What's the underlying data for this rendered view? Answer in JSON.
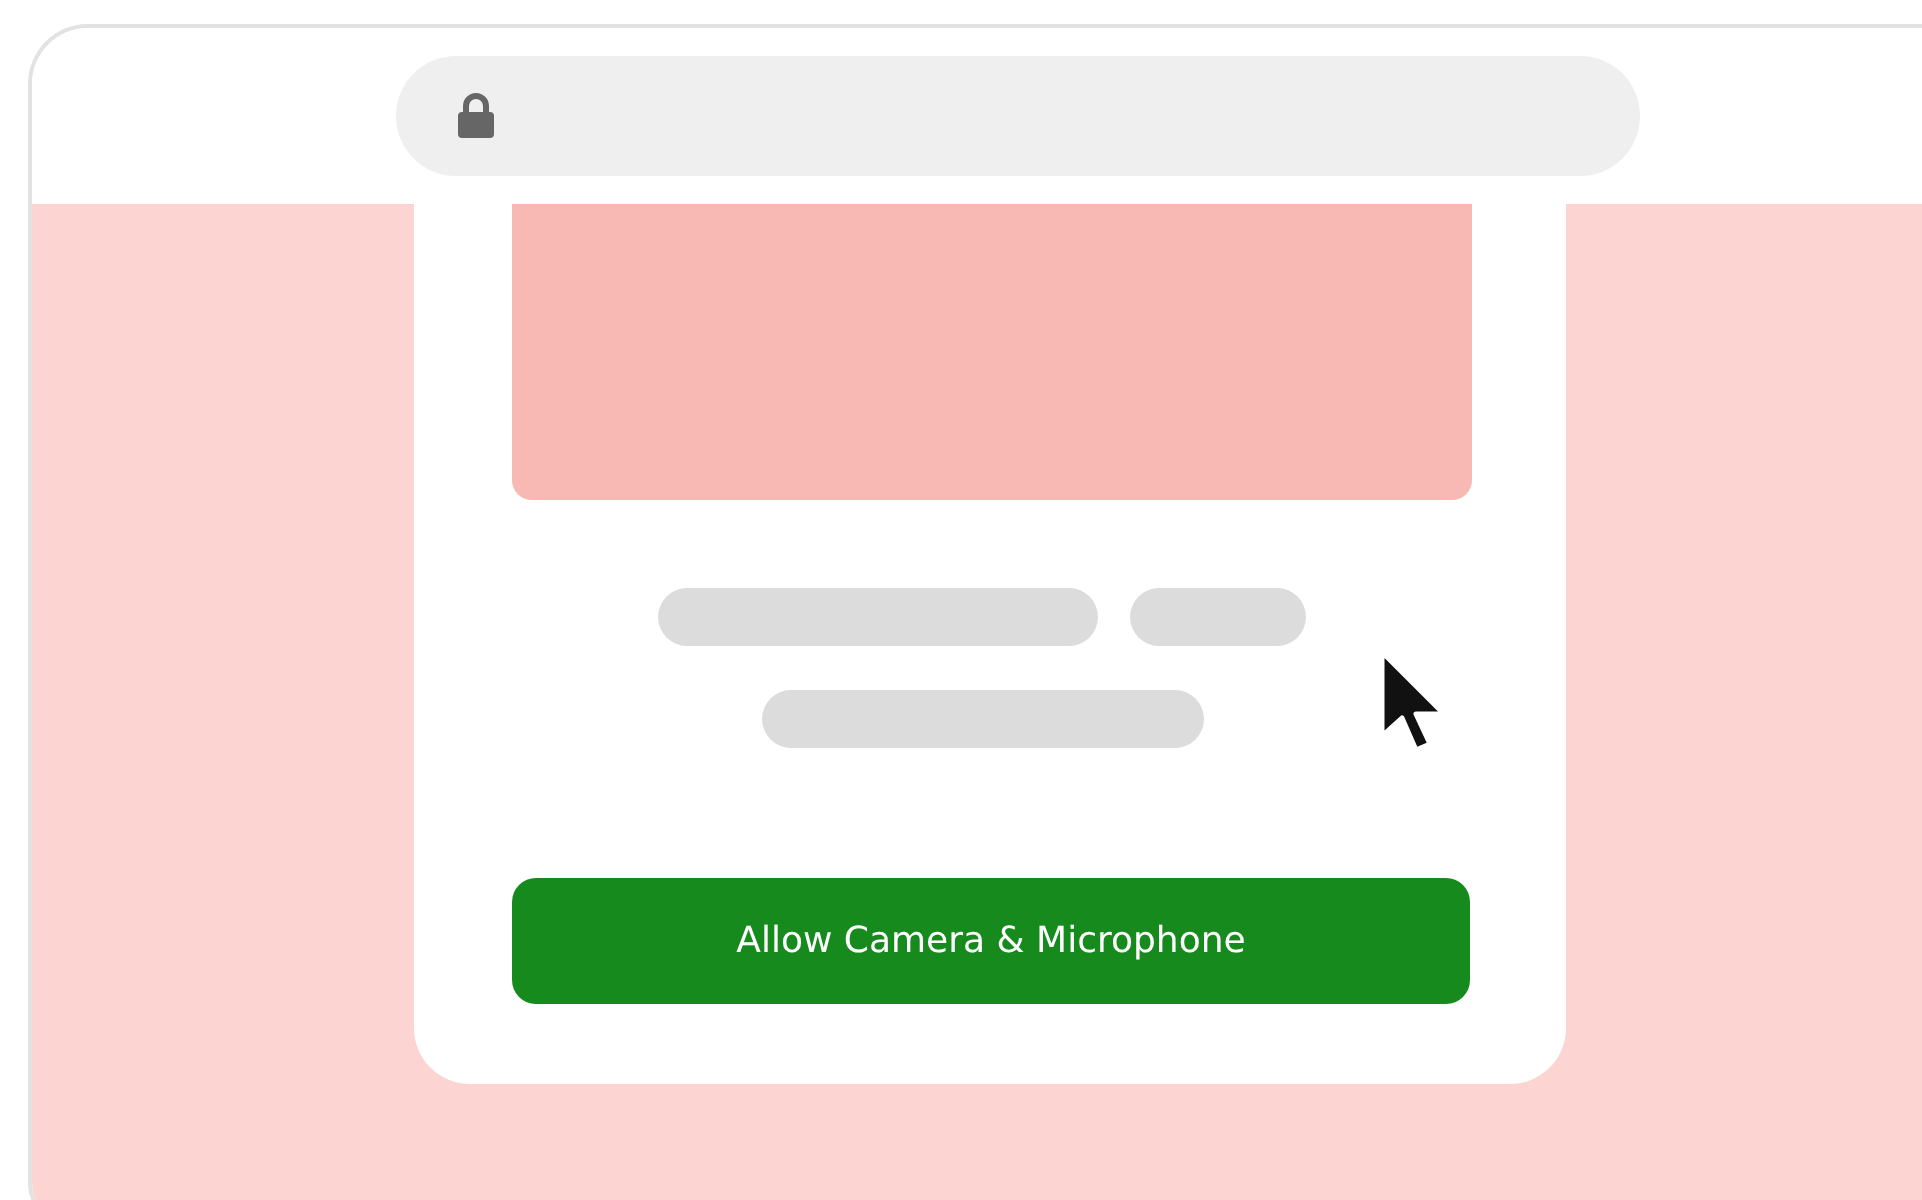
{
  "permission_card": {
    "button": "Allow Camera & Microphone"
  }
}
